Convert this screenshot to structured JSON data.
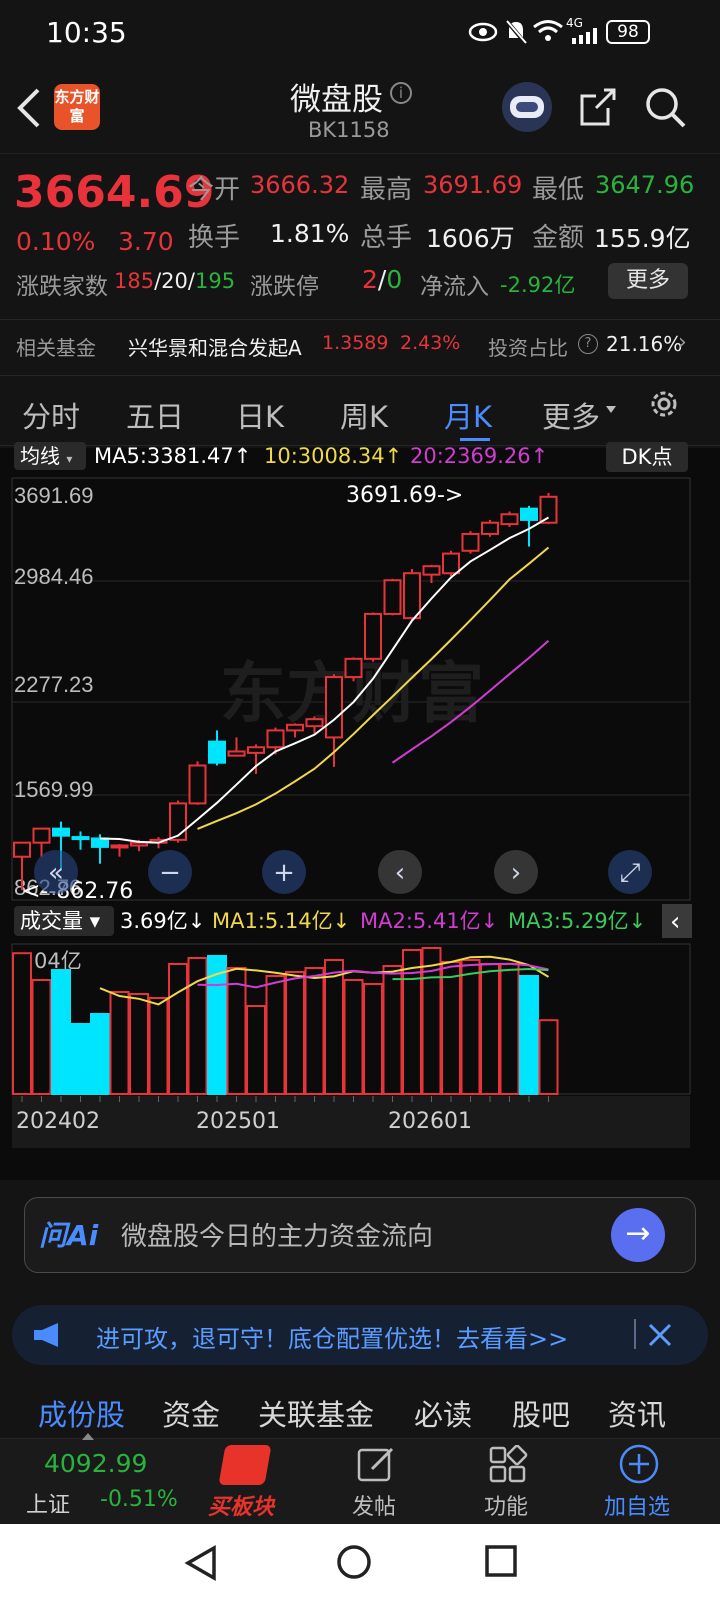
{
  "status": {
    "time": "10:35",
    "battery": "98",
    "network": "4G"
  },
  "header": {
    "logo": "东方财富",
    "title": "微盘股",
    "code": "BK1158"
  },
  "quote": {
    "price": "3664.69",
    "pct": "0.10%",
    "chg": "3.70",
    "open_label": "今开",
    "open": "3666.32",
    "high_label": "最高",
    "high": "3691.69",
    "low_label": "最低",
    "low": "3647.96",
    "turnover_label": "换手",
    "turnover": "1.81%",
    "vol_label": "总手",
    "vol": "1606万",
    "amount_label": "金额",
    "amount": "155.9亿",
    "adv_label": "涨跌家数",
    "adv_up": "185",
    "adv_flat": "20",
    "adv_down": "195",
    "limit_label": "涨跌停",
    "limit_up": "2",
    "limit_down": "0",
    "inflow_label": "净流入",
    "inflow": "-2.92亿",
    "more_btn": "更多"
  },
  "fund": {
    "label": "相关基金",
    "name": "兴华景和混合发起A",
    "nav": "1.3589",
    "pct": "2.43%",
    "ratio_label": "投资占比",
    "ratio": "21.16%"
  },
  "tabs": [
    "分时",
    "五日",
    "日K",
    "周K",
    "月K",
    "更多"
  ],
  "active_tab": 4,
  "ma_row": {
    "selector": "均线",
    "ma5": "MA5:3381.47↑",
    "ma10": "10:3008.34↑",
    "ma20": "20:2369.26↑",
    "dk": "DK点"
  },
  "price_axis": [
    "3691.69",
    "2984.46",
    "2277.23",
    "1569.99",
    "862.76"
  ],
  "max_label": "3691.69->",
  "min_label": "<--862.76",
  "watermark": "东方财富",
  "vol_row": {
    "selector": "成交量",
    "vol": "3.69亿↓",
    "ma1": "MA1:5.14亿↓",
    "ma2": "MA2:5.41亿↓",
    "ma3": "MA3:5.29亿↓"
  },
  "vol_axis_max": "7.04亿",
  "dates": [
    "202402",
    "202501",
    "202601"
  ],
  "chart_data": {
    "type": "candlestick",
    "categories": [
      "2023-11",
      "2023-12",
      "2024-01",
      "2024-02",
      "2024-03",
      "2024-04",
      "2024-05",
      "2024-06",
      "2024-07",
      "2024-08",
      "2024-09",
      "2024-10",
      "2024-11",
      "2024-12",
      "2025-01",
      "2025-02",
      "2025-03",
      "2025-04",
      "2025-05",
      "2025-06",
      "2025-07",
      "2025-08",
      "2025-09",
      "2025-10",
      "2025-11",
      "2025-12",
      "2026-01",
      "2026-02"
    ],
    "ohlc": [
      [
        1100,
        1200,
        862.76,
        1200
      ],
      [
        1200,
        1300,
        1100,
        1300
      ],
      [
        1300,
        1350,
        1000,
        1250
      ],
      [
        1240,
        1280,
        1150,
        1230
      ],
      [
        1230,
        1260,
        1050,
        1170
      ],
      [
        1170,
        1190,
        1100,
        1180
      ],
      [
        1180,
        1220,
        1140,
        1200
      ],
      [
        1200,
        1240,
        1160,
        1220
      ],
      [
        1220,
        1500,
        1200,
        1480
      ],
      [
        1480,
        1780,
        1470,
        1750
      ],
      [
        1920,
        2000,
        1750,
        1770
      ],
      [
        1820,
        1950,
        1850,
        1850
      ],
      [
        1840,
        1900,
        1690,
        1880
      ],
      [
        1880,
        2020,
        1830,
        2000
      ],
      [
        2000,
        2050,
        1950,
        2040
      ],
      [
        2030,
        2100,
        1970,
        2080
      ],
      [
        1950,
        2400,
        1740,
        2380
      ],
      [
        2380,
        2520,
        2350,
        2510
      ],
      [
        2510,
        2840,
        2490,
        2830
      ],
      [
        2830,
        3080,
        2820,
        3070
      ],
      [
        2800,
        3150,
        2780,
        3120
      ],
      [
        3110,
        3180,
        3050,
        3170
      ],
      [
        3120,
        3280,
        3100,
        3260
      ],
      [
        3280,
        3420,
        3260,
        3400
      ],
      [
        3400,
        3500,
        3380,
        3480
      ],
      [
        3470,
        3560,
        3450,
        3540
      ],
      [
        3580,
        3600,
        3310,
        3500
      ],
      [
        3480,
        3691.69,
        3470,
        3664.69
      ]
    ],
    "volume_yi": [
      7.04,
      5.7,
      6.2,
      3.5,
      4.0,
      5.1,
      5.0,
      4.8,
      6.5,
      6.8,
      6.9,
      6.3,
      4.4,
      5.9,
      6.1,
      6.3,
      6.7,
      5.7,
      5.5,
      6.4,
      7.2,
      7.3,
      6.6,
      6.7,
      6.5,
      6.5,
      5.9,
      3.69
    ],
    "ylim": [
      862.76,
      3691.69
    ],
    "volume_max": "7.04亿",
    "ma_lines": [
      "MA5",
      "MA10",
      "MA20"
    ]
  },
  "ai": {
    "logo": "问Ai",
    "text": "微盘股今日的主力资金流向"
  },
  "banner": {
    "text": "进可攻，退可守！底仓配置优选！去看看>>"
  },
  "bottom_tabs": [
    "成份股",
    "资金",
    "关联基金",
    "必读",
    "股吧",
    "资讯"
  ],
  "dock": {
    "index_val": "4092.99",
    "index_name": "上证",
    "index_pct": "-0.51%",
    "buy": "买板块",
    "post": "发帖",
    "func": "功能",
    "add": "加自选"
  },
  "colors": {
    "up": "#e8333a",
    "down": "#00e5ff",
    "accent": "#4a8cff"
  }
}
